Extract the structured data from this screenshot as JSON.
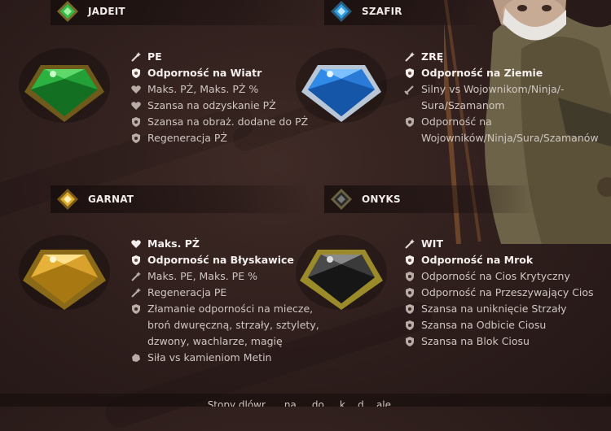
{
  "gems": {
    "jadeit": {
      "name": "JADEIT",
      "color": "#1fa83a",
      "stats": [
        {
          "icon": "wand-icon",
          "text": "PE",
          "bright": true
        },
        {
          "icon": "shield-icon",
          "text": "Odporność na Wiatr",
          "bright": true
        },
        {
          "icon": "heart-icon",
          "text": "Maks. PŻ, Maks. PŻ %",
          "bright": false
        },
        {
          "icon": "heart-icon",
          "text": "Szansa na odzyskanie PŻ",
          "bright": false
        },
        {
          "icon": "shield-icon",
          "text": "Szansa na obraż. dodane do PŻ",
          "bright": false
        },
        {
          "icon": "shield-icon",
          "text": "Regeneracja PŻ",
          "bright": false
        }
      ]
    },
    "szafir": {
      "name": "SZAFIR",
      "color": "#2a7fe0",
      "stats": [
        {
          "icon": "wand-icon",
          "text": "ZRĘ",
          "bright": true
        },
        {
          "icon": "shield-icon",
          "text": "Odporność na Ziemie",
          "bright": true
        },
        {
          "icon": "sword-icon",
          "text": "Silny vs Wojownikom/Ninja/-Sura/Szamanom",
          "bright": false
        },
        {
          "icon": "shield-icon",
          "text": "Odporność na Wojowników/Ninja/Sura/Szamanów",
          "bright": false
        }
      ]
    },
    "garnat": {
      "name": "GARNAT",
      "color": "#d6a21e",
      "stats": [
        {
          "icon": "heart-icon",
          "text": "Maks. PŻ",
          "bright": true
        },
        {
          "icon": "shield-icon",
          "text": "Odporność na Błyskawice",
          "bright": true
        },
        {
          "icon": "wand-icon",
          "text": "Maks. PE, Maks. PE %",
          "bright": false
        },
        {
          "icon": "wand-icon",
          "text": "Regeneracja PE",
          "bright": false
        },
        {
          "icon": "shield-icon",
          "text": "Złamanie odporności na miecze, broń dwuręczną, strzały, sztylety, dzwony, wachlarze, magię",
          "bright": false
        },
        {
          "icon": "stone-icon",
          "text": "Siła vs kamieniom Metin",
          "bright": false
        }
      ]
    },
    "onyks": {
      "name": "ONYKS",
      "color": "#3a3a3a",
      "stats": [
        {
          "icon": "wand-icon",
          "text": "WIT",
          "bright": true
        },
        {
          "icon": "shield-icon",
          "text": "Odporność na Mrok",
          "bright": true
        },
        {
          "icon": "shield-icon",
          "text": "Odporność na Cios Krytyczny",
          "bright": false
        },
        {
          "icon": "shield-icon",
          "text": "Odporność na Przeszywający Cios",
          "bright": false
        },
        {
          "icon": "shield-icon",
          "text": "Szansa na uniknięcie Strzały",
          "bright": false
        },
        {
          "icon": "shield-icon",
          "text": "Szansa na Odbicie Ciosu",
          "bright": false
        },
        {
          "icon": "shield-icon",
          "text": "Szansa na Blok Ciosu",
          "bright": false
        }
      ]
    }
  },
  "footer": {
    "text": "Stopy dlówr, ... na ... do ... k... d... ale ..."
  }
}
